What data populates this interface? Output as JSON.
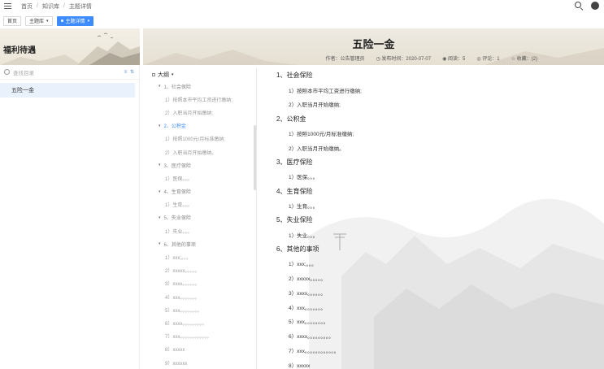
{
  "topnav": {
    "crumbs": [
      "首页",
      "知识库",
      "主题详情"
    ]
  },
  "tabs": [
    {
      "label": "首页",
      "active": false
    },
    {
      "label": "主题库",
      "active": false
    },
    {
      "label": "主题详情",
      "active": true
    }
  ],
  "sidebar": {
    "title": "福利待遇",
    "search_placeholder": "查找目录",
    "items": [
      {
        "label": "五险一金",
        "selected": true
      }
    ]
  },
  "article": {
    "title": "五险一金",
    "meta": {
      "author": "作者：公告管理员",
      "published": "发布时间：2020-07-07",
      "views": "阅读：5",
      "comments": "评论：1",
      "favorites": "收藏：(2)"
    }
  },
  "toc": {
    "header": "大纲",
    "items": [
      {
        "level": 1,
        "text": "1、社会保险"
      },
      {
        "level": 2,
        "text": "1）按照本市平均工资进行缴纳;"
      },
      {
        "level": 2,
        "text": "2）入职当月开始缴纳;"
      },
      {
        "level": 1,
        "text": "2、公积金"
      },
      {
        "level": 2,
        "text": "1）按照1000元/月标准缴纳;"
      },
      {
        "level": 2,
        "text": "2）入职当月开始缴纳。"
      },
      {
        "level": 1,
        "text": "3、医疗保险"
      },
      {
        "level": 2,
        "text": "1）医保。。。"
      },
      {
        "level": 1,
        "text": "4、生育保险"
      },
      {
        "level": 2,
        "text": "1）生育。。。"
      },
      {
        "level": 1,
        "text": "5、失业保险"
      },
      {
        "level": 2,
        "text": "1）失业。。。"
      },
      {
        "level": 1,
        "text": "6、其他的事项"
      },
      {
        "level": 2,
        "text": "1）xxx;。。。"
      },
      {
        "level": 2,
        "text": "2）xxxxx。。。。。"
      },
      {
        "level": 2,
        "text": "3）xxxx。。。。。。"
      },
      {
        "level": 2,
        "text": "4）xxx。。。。。。。"
      },
      {
        "level": 2,
        "text": "5）xxx。。。。。。。。"
      },
      {
        "level": 2,
        "text": "6）xxxx。。。。。。。。。"
      },
      {
        "level": 2,
        "text": "7）xxx。。。。。。。。。。。。"
      },
      {
        "level": 2,
        "text": "8）xxxxx"
      },
      {
        "level": 2,
        "text": "9）xxxxxx"
      }
    ]
  },
  "content": {
    "lines": [
      {
        "type": "h",
        "text": "1、社会保险"
      },
      {
        "type": "p",
        "text": "1）按照本市平均工资进行缴纳;"
      },
      {
        "type": "p",
        "text": "2）入职当月开始缴纳;"
      },
      {
        "type": "h",
        "text": "2、公积金"
      },
      {
        "type": "p",
        "text": "1）按照1000元/月标准缴纳;"
      },
      {
        "type": "p",
        "text": "2）入职当月开始缴纳。"
      },
      {
        "type": "h",
        "text": "3、医疗保险"
      },
      {
        "type": "p",
        "text": "1）医保。。。"
      },
      {
        "type": "h",
        "text": "4、生育保险"
      },
      {
        "type": "p",
        "text": "1）生育。。。"
      },
      {
        "type": "h",
        "text": "5、失业保险"
      },
      {
        "type": "p",
        "text": "1）失业。。。"
      },
      {
        "type": "h",
        "text": "6、其他的事项"
      },
      {
        "type": "p",
        "text": "1）xxx;。。。"
      },
      {
        "type": "p",
        "text": "2）xxxxx。。。。。"
      },
      {
        "type": "p",
        "text": "3）xxxx。。。。。。"
      },
      {
        "type": "p",
        "text": "4）xxx。。。。。。。"
      },
      {
        "type": "p",
        "text": "5）xxx。。。。。。。。"
      },
      {
        "type": "p",
        "text": "6）xxxx。。。。。。。。。"
      },
      {
        "type": "p",
        "text": "7）xxx。。。。。。。。。。。。"
      },
      {
        "type": "p",
        "text": "8）xxxxx"
      }
    ]
  }
}
